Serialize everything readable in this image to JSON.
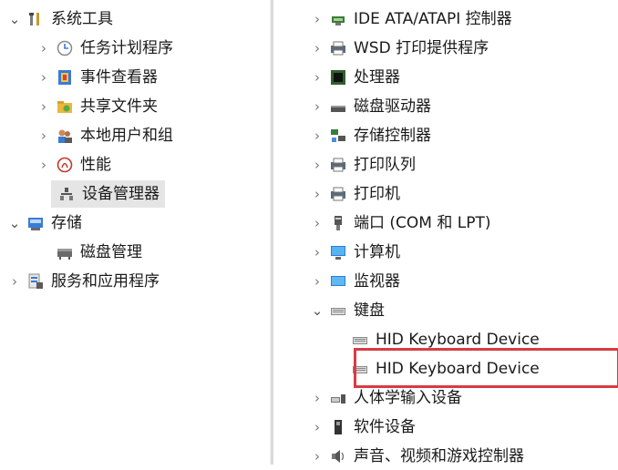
{
  "left_tree": [
    {
      "label": "系统工具",
      "chevron": "down",
      "icon": "tools-icon"
    },
    {
      "label": "任务计划程序",
      "chevron": "right",
      "icon": "clock-icon"
    },
    {
      "label": "事件查看器",
      "chevron": "right",
      "icon": "event-viewer-icon"
    },
    {
      "label": "共享文件夹",
      "chevron": "right",
      "icon": "shared-folder-icon"
    },
    {
      "label": "本地用户和组",
      "chevron": "right",
      "icon": "users-icon"
    },
    {
      "label": "性能",
      "chevron": "right",
      "icon": "performance-icon"
    },
    {
      "label": "设备管理器",
      "chevron": "none",
      "icon": "device-manager-icon",
      "selected": true
    },
    {
      "label": "存储",
      "chevron": "down",
      "icon": "storage-icon"
    },
    {
      "label": "磁盘管理",
      "chevron": "none",
      "icon": "disk-management-icon"
    },
    {
      "label": "服务和应用程序",
      "chevron": "right",
      "icon": "services-icon"
    }
  ],
  "right_tree": [
    {
      "label": "IDE ATA/ATAPI 控制器",
      "chevron": "right",
      "icon": "ide-controller-icon"
    },
    {
      "label": "WSD 打印提供程序",
      "chevron": "right",
      "icon": "printer-icon"
    },
    {
      "label": "处理器",
      "chevron": "right",
      "icon": "processor-icon"
    },
    {
      "label": "磁盘驱动器",
      "chevron": "right",
      "icon": "disk-drive-icon"
    },
    {
      "label": "存储控制器",
      "chevron": "right",
      "icon": "storage-controller-icon"
    },
    {
      "label": "打印队列",
      "chevron": "right",
      "icon": "printer-icon"
    },
    {
      "label": "打印机",
      "chevron": "right",
      "icon": "printer-icon"
    },
    {
      "label": "端口 (COM 和 LPT)",
      "chevron": "right",
      "icon": "port-icon"
    },
    {
      "label": "计算机",
      "chevron": "right",
      "icon": "computer-icon"
    },
    {
      "label": "监视器",
      "chevron": "right",
      "icon": "monitor-icon"
    },
    {
      "label": "键盘",
      "chevron": "down",
      "icon": "keyboard-icon"
    },
    {
      "label": "HID Keyboard Device",
      "chevron": "none",
      "icon": "keyboard-icon"
    },
    {
      "label": "HID Keyboard Device",
      "chevron": "none",
      "icon": "keyboard-icon",
      "highlighted": true
    },
    {
      "label": "人体学输入设备",
      "chevron": "right",
      "icon": "hid-icon"
    },
    {
      "label": "软件设备",
      "chevron": "right",
      "icon": "software-device-icon"
    },
    {
      "label": "声音、视频和游戏控制器",
      "chevron": "right",
      "icon": "sound-icon"
    }
  ],
  "chevrons": {
    "right": "›",
    "down": "⌄"
  },
  "colors": {
    "highlight_border": "#d93a44",
    "selected_bg": "#e5e5e5"
  }
}
